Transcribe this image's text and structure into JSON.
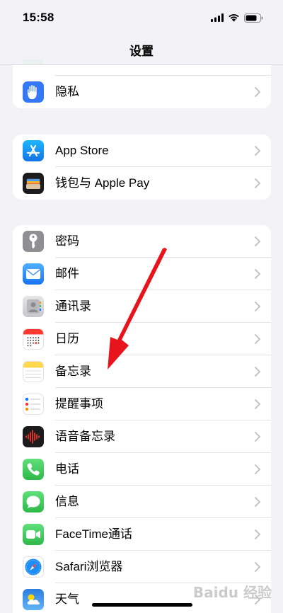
{
  "status_bar": {
    "time": "15:58"
  },
  "nav": {
    "title": "设置"
  },
  "group_privacy": {
    "items": [
      {
        "label": "隐私",
        "icon": "hand-icon",
        "color": "#3478f6"
      }
    ]
  },
  "group_store": {
    "items": [
      {
        "label": "App Store",
        "icon": "app-store-icon",
        "color": "#1e8cf5"
      },
      {
        "label": "钱包与 Apple Pay",
        "icon": "wallet-icon",
        "color": "#1c1c1e"
      }
    ]
  },
  "group_apps": {
    "items": [
      {
        "label": "密码",
        "icon": "key-icon",
        "color": "#8e8e93"
      },
      {
        "label": "邮件",
        "icon": "mail-icon",
        "color": "#2f8af6"
      },
      {
        "label": "通讯录",
        "icon": "contacts-icon",
        "color": "#c9c9ce"
      },
      {
        "label": "日历",
        "icon": "calendar-icon",
        "color": "#ffffff"
      },
      {
        "label": "备忘录",
        "icon": "notes-icon",
        "color": "#ffd84d"
      },
      {
        "label": "提醒事项",
        "icon": "reminders-icon",
        "color": "#ffffff"
      },
      {
        "label": "语音备忘录",
        "icon": "voice-memos-icon",
        "color": "#1c1c1e"
      },
      {
        "label": "电话",
        "icon": "phone-icon",
        "color": "#34c759"
      },
      {
        "label": "信息",
        "icon": "messages-icon",
        "color": "#34c759"
      },
      {
        "label": "FaceTime通话",
        "icon": "facetime-icon",
        "color": "#34c759"
      },
      {
        "label": "Safari浏览器",
        "icon": "safari-icon",
        "color": "#1e8cf5"
      },
      {
        "label": "天气",
        "icon": "weather-icon",
        "color": "#3a8ee6"
      }
    ]
  },
  "annotation": {
    "arrow_color": "#e8141c"
  },
  "watermark": {
    "text": "Baidu 经验"
  }
}
